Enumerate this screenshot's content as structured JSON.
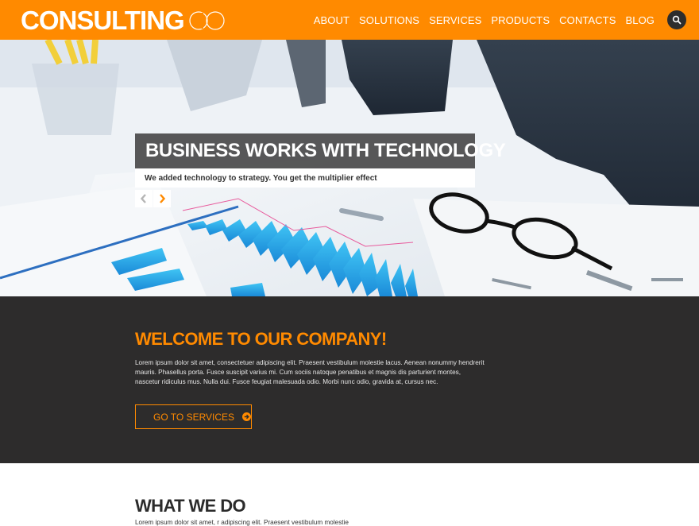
{
  "header": {
    "logo_text": "CONSULTING",
    "logo_suffix": "CO",
    "nav": [
      "ABOUT",
      "SOLUTIONS",
      "SERVICES",
      "PRODUCTS",
      "CONTACTS",
      "BLOG"
    ],
    "search_icon": "search-icon"
  },
  "hero": {
    "title": "BUSINESS WORKS WITH TECHNOLOGY",
    "subtitle": "We added technology to strategy. You get the multiplier effect",
    "prev_icon": "chevron-left-icon",
    "next_icon": "chevron-right-icon"
  },
  "welcome": {
    "title": "WELCOME TO OUR COMPANY!",
    "text": "Lorem ipsum dolor sit amet, consectetuer adipiscing elit. Praesent vestibulum molestie lacus. Aenean nonummy hendrerit mauris. Phasellus porta. Fusce suscipit varius mi. Cum sociis natoque penatibus et magnis dis parturient montes, nascetur ridiculus mus. Nulla dui. Fusce feugiat malesuada odio. Morbi nunc odio, gravida at, cursus nec.",
    "cta_label": "GO TO SERVICES",
    "cta_icon": "arrow-circle-right-icon"
  },
  "what_we_do": {
    "title": "WHAT WE DO",
    "text": "Lorem ipsum dolor sit amet, r adipiscing elit. Praesent vestibulum molestie"
  },
  "colors": {
    "accent": "#ff8a00",
    "dark": "#2d2c2c"
  }
}
